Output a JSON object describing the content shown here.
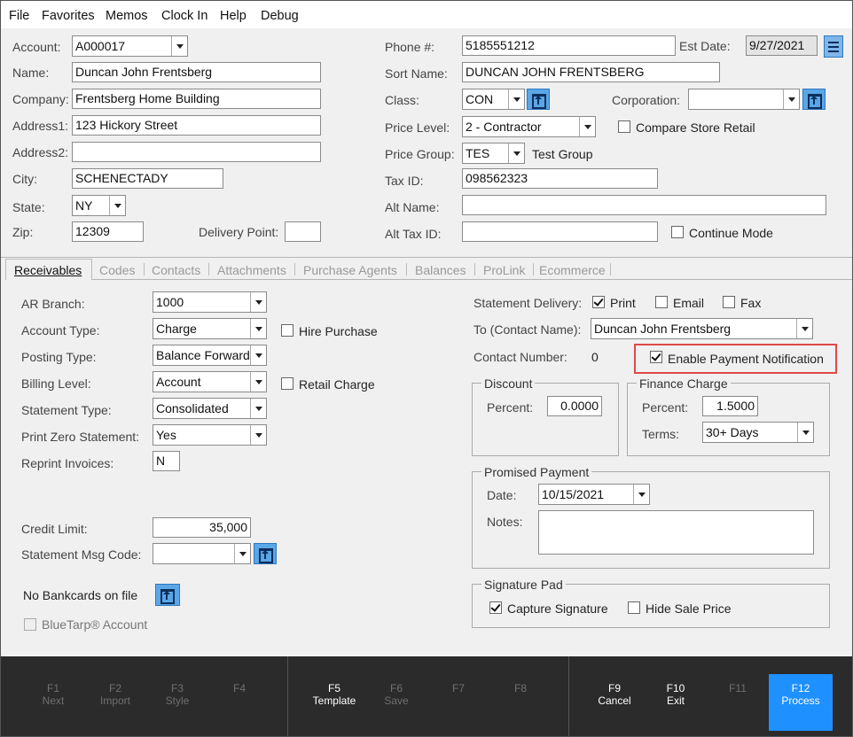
{
  "menu": [
    "File",
    "Favorites",
    "Memos",
    "Clock In",
    "Help",
    "Debug"
  ],
  "top": {
    "account_label": "Account:",
    "account": "A000017",
    "name_label": "Name:",
    "name": "Duncan John Frentsberg",
    "company_label": "Company:",
    "company": "Frentsberg Home Building",
    "address1_label": "Address1:",
    "address1": "123 Hickory Street",
    "address2_label": "Address2:",
    "address2": "",
    "city_label": "City:",
    "city": "SCHENECTADY",
    "state_label": "State:",
    "state": "NY",
    "zip_label": "Zip:",
    "zip": "12309",
    "delivery_label": "Delivery Point:",
    "delivery": "",
    "phone_label": "Phone #:",
    "phone": "5185551212",
    "estdate_label": "Est Date:",
    "estdate": "9/27/2021",
    "sortname_label": "Sort Name:",
    "sortname": "DUNCAN JOHN FRENTSBERG",
    "class_label": "Class:",
    "class": "CON",
    "corporation_label": "Corporation:",
    "corporation": "",
    "pricelevel_label": "Price Level:",
    "pricelevel": "2 - Contractor",
    "compare_label": "Compare Store Retail",
    "pricegroup_label": "Price Group:",
    "pricegroup": "TES",
    "pricegroup_desc": "Test Group",
    "taxid_label": "Tax ID:",
    "taxid": "098562323",
    "altname_label": "Alt  Name:",
    "altname": "",
    "alttaxid_label": "Alt Tax ID:",
    "alttaxid": "",
    "continue_label": "Continue Mode"
  },
  "tabs": [
    "Receivables",
    "Codes",
    "Contacts",
    "Attachments",
    "Purchase Agents",
    "Balances",
    "ProLink",
    "Ecommerce"
  ],
  "recv": {
    "arbranch_label": "AR Branch:",
    "arbranch": "1000",
    "accttype_label": "Account Type:",
    "accttype": "Charge",
    "hire_label": "Hire Purchase",
    "posting_label": "Posting Type:",
    "posting": "Balance Forward",
    "billing_label": "Billing Level:",
    "billing": "Account",
    "retail_label": "Retail Charge",
    "stmttype_label": "Statement Type:",
    "stmttype": "Consolidated",
    "printzero_label": "Print Zero Statement:",
    "printzero": "Yes",
    "reprint_label": "Reprint Invoices:",
    "reprint": "N",
    "credit_label": "Credit Limit:",
    "credit": "35,000",
    "msgcode_label": "Statement Msg Code:",
    "msgcode": "",
    "bankcards_label": "No Bankcards on file",
    "bluetarp_label": "BlueTarp® Account",
    "delivery_label": "Statement Delivery:",
    "print_label": "Print",
    "email_label": "Email",
    "fax_label": "Fax",
    "tocontact_label": "To (Contact Name):",
    "tocontact": "Duncan John Frentsberg",
    "contactnum_label": "Contact Number:",
    "contactnum": "0",
    "enable_label": "Enable Payment Notification",
    "discount_title": "Discount",
    "discount_pct_label": "Percent:",
    "discount_pct": "0.0000",
    "finance_title": "Finance Charge",
    "finance_pct_label": "Percent:",
    "finance_pct": "1.5000",
    "terms_label": "Terms:",
    "terms": "30+ Days",
    "promised_title": "Promised Payment",
    "date_label": "Date:",
    "date": "10/15/2021",
    "notes_label": "Notes:",
    "notes": "",
    "sig_title": "Signature Pad",
    "capture_label": "Capture Signature",
    "hide_label": "Hide Sale Price"
  },
  "fkeys": [
    {
      "key": "F1",
      "label": "Next"
    },
    {
      "key": "F2",
      "label": "Import"
    },
    {
      "key": "F3",
      "label": "Style"
    },
    {
      "key": "F4",
      "label": ""
    },
    {
      "key": "F5",
      "label": "Template"
    },
    {
      "key": "F6",
      "label": "Save"
    },
    {
      "key": "F7",
      "label": ""
    },
    {
      "key": "F8",
      "label": ""
    },
    {
      "key": "F9",
      "label": "Cancel"
    },
    {
      "key": "F10",
      "label": "Exit"
    },
    {
      "key": "F11",
      "label": ""
    },
    {
      "key": "F12",
      "label": "Process"
    }
  ]
}
